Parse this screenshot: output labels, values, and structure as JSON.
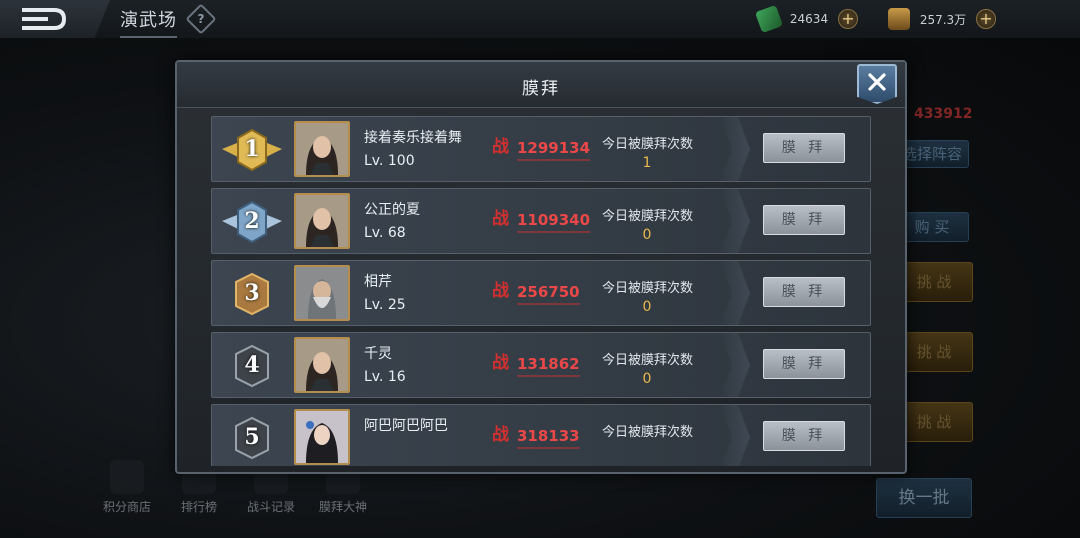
{
  "app": {
    "title": "演武场",
    "help_glyph": "?"
  },
  "currency": {
    "gems": "24634",
    "gold": "257.3万"
  },
  "background": {
    "power_value": "433912",
    "buttons": [
      "选择阵容",
      "购 买",
      "挑 战",
      "挑 战",
      "挑 战"
    ],
    "refresh_button": "换一批",
    "nav": [
      "积分商店",
      "排行榜",
      "战斗记录",
      "膜拜大神"
    ]
  },
  "modal": {
    "title": "膜拜",
    "close_glyph": "✕",
    "power_glyph": "战",
    "count_label": "今日被膜拜次数",
    "worship_button": "膜 拜",
    "rows": [
      {
        "rank": "1",
        "name": "接着奏乐接着舞",
        "level": "Lv. 100",
        "power": "1299134",
        "count": "1"
      },
      {
        "rank": "2",
        "name": "公正的夏",
        "level": "Lv. 68",
        "power": "1109340",
        "count": "0"
      },
      {
        "rank": "3",
        "name": "相芹",
        "level": "Lv. 25",
        "power": "256750",
        "count": "0"
      },
      {
        "rank": "4",
        "name": "千灵",
        "level": "Lv. 16",
        "power": "131862",
        "count": "0"
      },
      {
        "rank": "5",
        "name": "阿巴阿巴阿巴",
        "level": "",
        "power": "318133",
        "count": ""
      }
    ]
  },
  "colors": {
    "gold_rank": "#d8b04a",
    "silver_rank": "#a9c4dc",
    "bronze_rank": "#a9793f",
    "dark_rank": "#4a4f55",
    "power": "#ea4848",
    "count": "#e9b84a"
  }
}
